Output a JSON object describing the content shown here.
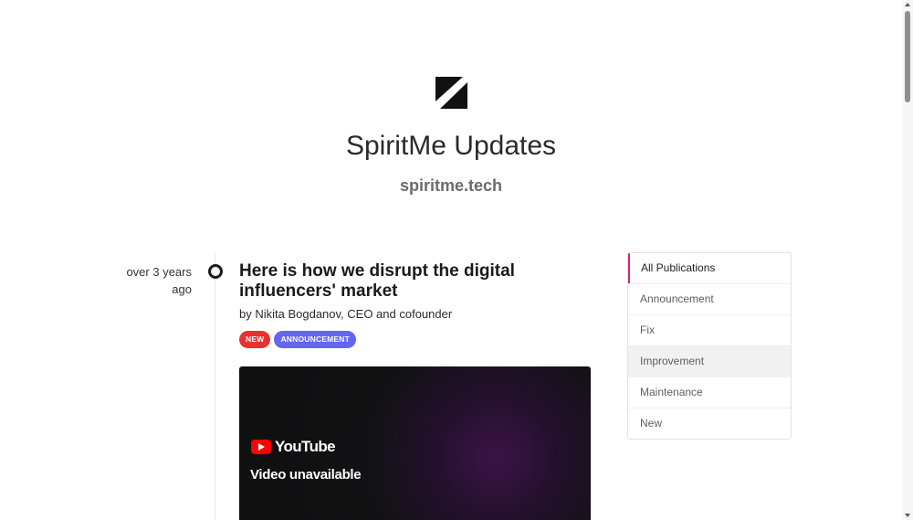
{
  "header": {
    "logo_icon": "spiritme-logo-icon",
    "title": "SpiritMe Updates",
    "url": "spiritme.tech"
  },
  "post": {
    "date": "over 3 years ago",
    "title": "Here is how we disrupt the digital influencers' market",
    "author": "by Nikita Bogdanov, CEO and cofounder",
    "tags": [
      "NEW",
      "ANNOUNCEMENT"
    ],
    "video": {
      "brand": "YouTube",
      "message": "Video unavailable"
    }
  },
  "filter": {
    "items": [
      "All Publications",
      "Announcement",
      "Fix",
      "Improvement",
      "Maintenance",
      "New"
    ],
    "active": "All Publications",
    "accent_color": "#d6247f"
  },
  "colors": {
    "tag_new": "#e8322d",
    "tag_announcement": "#6366f1"
  }
}
